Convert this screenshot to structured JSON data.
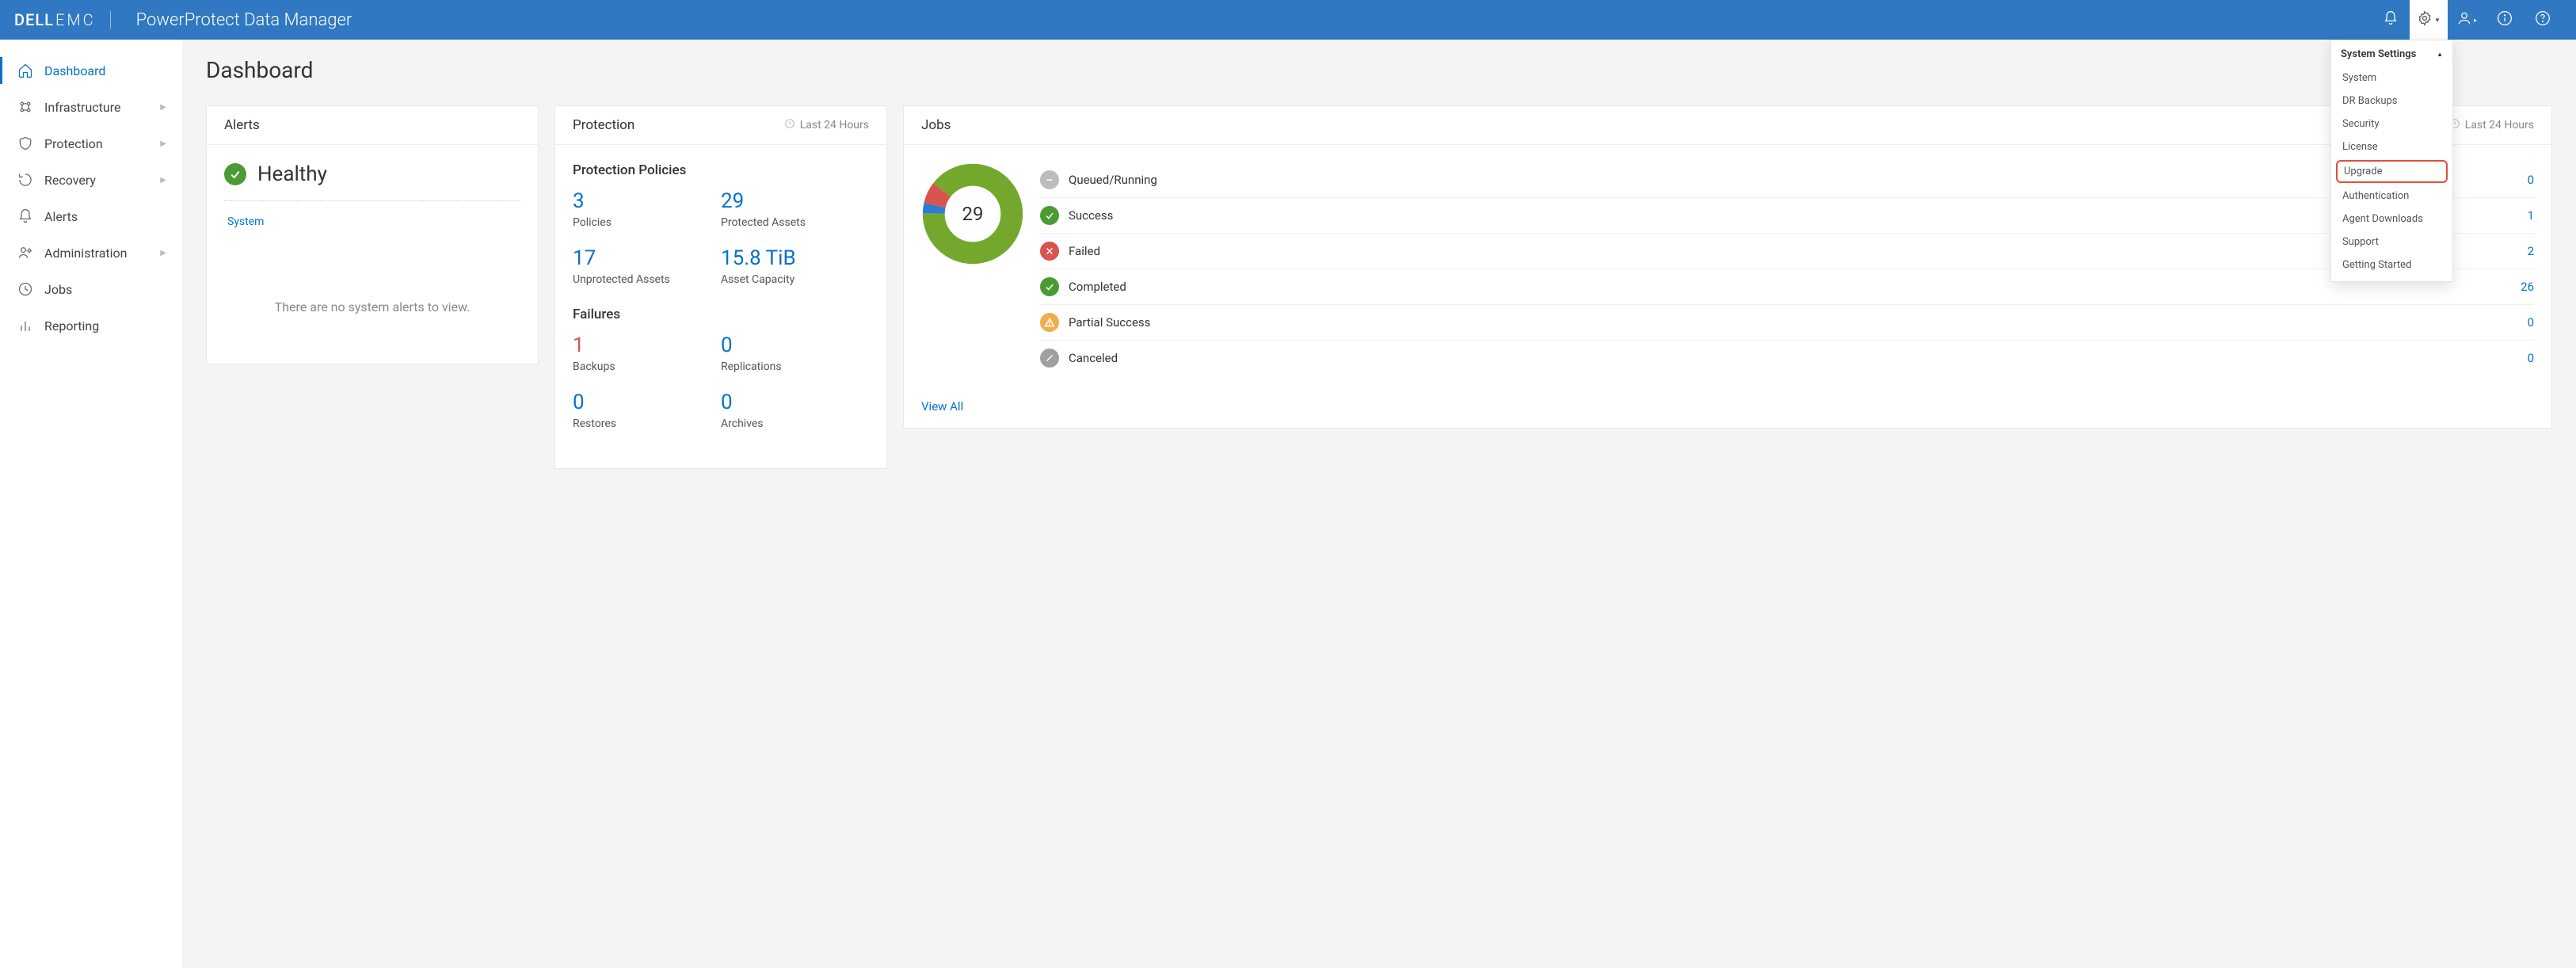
{
  "brand": {
    "dell": "DELL",
    "emc": "EMC"
  },
  "app_title": "PowerProtect Data Manager",
  "dropdown": {
    "title": "System Settings",
    "items": [
      "System",
      "DR Backups",
      "Security",
      "License",
      "Upgrade",
      "Authentication",
      "Agent Downloads",
      "Support",
      "Getting Started"
    ],
    "highlight": "Upgrade"
  },
  "sidebar": {
    "items": [
      {
        "label": "Dashboard",
        "active": true,
        "expandable": false
      },
      {
        "label": "Infrastructure",
        "active": false,
        "expandable": true
      },
      {
        "label": "Protection",
        "active": false,
        "expandable": true
      },
      {
        "label": "Recovery",
        "active": false,
        "expandable": true
      },
      {
        "label": "Alerts",
        "active": false,
        "expandable": false
      },
      {
        "label": "Administration",
        "active": false,
        "expandable": true
      },
      {
        "label": "Jobs",
        "active": false,
        "expandable": false
      },
      {
        "label": "Reporting",
        "active": false,
        "expandable": false
      }
    ]
  },
  "page_title": "Dashboard",
  "alerts": {
    "card_title": "Alerts",
    "status_label": "Healthy",
    "system_link": "System",
    "empty_text": "There are no system alerts to view."
  },
  "protection": {
    "card_title": "Protection",
    "time_range": "Last 24 Hours",
    "policies_title": "Protection Policies",
    "policies": [
      {
        "value": "3",
        "label": "Policies"
      },
      {
        "value": "29",
        "label": "Protected Assets"
      },
      {
        "value": "17",
        "label": "Unprotected Assets"
      },
      {
        "value": "15.8 TiB",
        "label": "Asset Capacity"
      }
    ],
    "failures_title": "Failures",
    "failures": [
      {
        "value": "1",
        "label": "Backups",
        "red": true
      },
      {
        "value": "0",
        "label": "Replications",
        "red": false
      },
      {
        "value": "0",
        "label": "Restores",
        "red": false
      },
      {
        "value": "0",
        "label": "Archives",
        "red": false
      }
    ]
  },
  "jobs": {
    "card_title": "Jobs",
    "time_range": "Last 24 Hours",
    "total": "29",
    "rows": [
      {
        "label": "Queued/Running",
        "count": "0",
        "color": "#bdbdbd",
        "icon": "dash"
      },
      {
        "label": "Success",
        "count": "1",
        "color": "#4b9b33",
        "icon": "check"
      },
      {
        "label": "Failed",
        "count": "2",
        "color": "#d9534f",
        "icon": "x"
      },
      {
        "label": "Completed",
        "count": "26",
        "color": "#4b9b33",
        "icon": "check"
      },
      {
        "label": "Partial Success",
        "count": "0",
        "color": "#f0ad4e",
        "icon": "warn"
      },
      {
        "label": "Canceled",
        "count": "0",
        "color": "#a0a0a0",
        "icon": "slash"
      }
    ],
    "view_all": "View All"
  },
  "chart_data": {
    "type": "pie",
    "title": "Jobs in Last 24 Hours",
    "total": 29,
    "series": [
      {
        "name": "Success",
        "value": 1,
        "color": "#2e7bd1"
      },
      {
        "name": "Failed",
        "value": 2,
        "color": "#d9534f"
      },
      {
        "name": "Completed",
        "value": 26,
        "color": "#74a82d"
      }
    ]
  }
}
